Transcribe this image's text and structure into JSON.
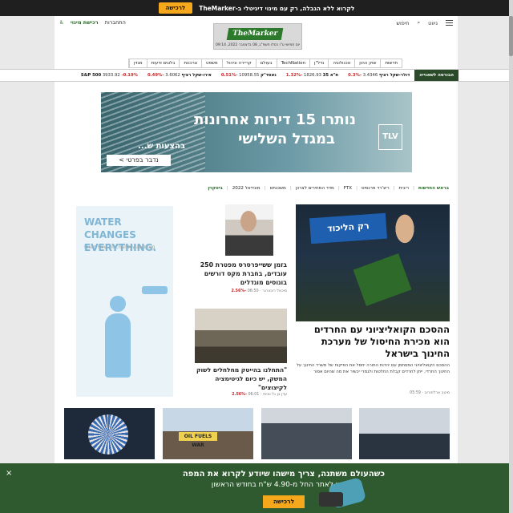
{
  "promo": {
    "text": "לקרוא ללא הגבלה, רק עם מינוי דיגיטלי ב-TheMarker",
    "button": "לרכישה"
  },
  "header": {
    "menu_label": "ניווט",
    "search_label": "חיפוש",
    "login": "התחברות",
    "subscribe": "רכישת מינוי",
    "logo": "TheMarker",
    "date_line": "יום חמישי ט\"ו כסלו תשפ\"ג, 08 בדצמבר 2022, 09:14"
  },
  "nav": [
    "חדשות",
    "שוק ההון",
    "טכנולוגיה",
    "נדל\"ן",
    "TechNation",
    "בעולם",
    "קריירה וניהול",
    "משפט",
    "צרכנות",
    "בלוגים ודעות",
    "מגזין"
  ],
  "ticker": {
    "live": "הבורסה לשאנייה",
    "items": [
      {
        "name": "דולר-שקל רציף",
        "value": "3.4346",
        "change": "-0.3%"
      },
      {
        "name": "ת\"א 35",
        "value": "1826.93",
        "change": "-1.32%"
      },
      {
        "name": "נאסד\"ק",
        "value": "10958.55",
        "change": "-0.51%"
      },
      {
        "name": "אירו-שקל רציף",
        "value": "3.6062",
        "change": "-0.49%"
      },
      {
        "name": "S&P 500",
        "value": "3933.92",
        "change": "-0.19%"
      }
    ]
  },
  "ad": {
    "headline1": "נותרו 15 דירות אחרונות",
    "headline2": "במגדל השלישי",
    "offer": "בהצעות ש...",
    "button": "נדבר בפרטי >",
    "brand": "TLV"
  },
  "topics": {
    "label": "בראש החדשות",
    "items": [
      "ריבית",
      "ריצ'רד פרנסיס",
      "FTX",
      "מדד המחירים לצרכן",
      "משכנתא",
      "מונדיאל 2022",
      "ביטקוין"
    ]
  },
  "main_article": {
    "title": "ההסכם הקואליציוני עם החרדים הוא מכירת החיסול של מערכת החינוך בישראל",
    "summary": "ההסכם הקואליציוני המסתמן עם יהדות התורה יחסל את הפיקוח של משרד החינוך על החינוך החרדי, ייתן לחרדים קבלת החלטות ולגמרי יכשיר את מה שהיום אסור",
    "author": "מיטב ארלוזורוב",
    "time": "05:59"
  },
  "mid_article1": {
    "title": "בזמן ששייפרסרס מפטרת 250 עובדים, בחברת מקס דורשים בונוסים מוגדלים",
    "author": "מיכאל רוכוורגר",
    "time": "06:50",
    "change": "-2.56%"
  },
  "mid_article2": {
    "title": "\"התחלנו בהייטק מחלחלים לשוק המשק, יש כיום לגיטימציה לקיצוצים\"",
    "author": "עדן בן גל ואיתי",
    "time": "06:01",
    "change": "-2.56%"
  },
  "water_ad": {
    "headline": "WATER CHANGES EVERYTHING.",
    "sub": "learn how at charitywater.org"
  },
  "thumbs": {
    "t3_sign": "OIL FUELS WAR"
  },
  "bottom_banner": {
    "line1": "כשהעולם משתנה, צריך מישהו שיודע לקרוא את המפה",
    "line2": "מינוי לאתר החל מ-4.90 ש\"ח בחודש הראשון",
    "button": "לרכישה",
    "close": "×"
  }
}
